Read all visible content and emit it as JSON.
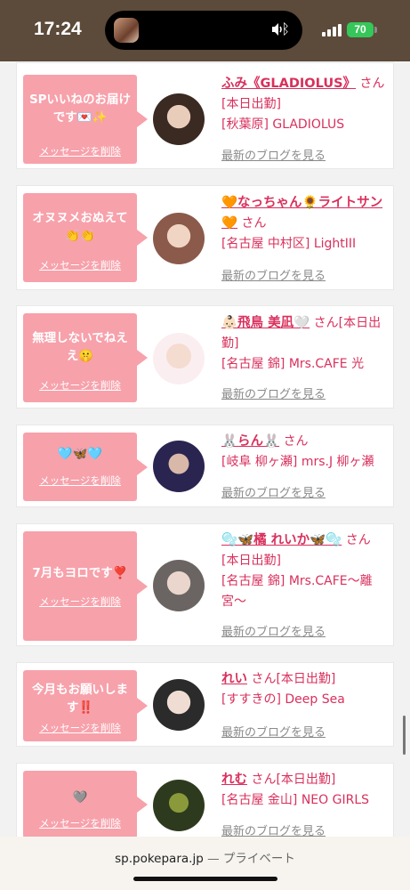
{
  "status": {
    "time": "17:24",
    "battery": "70"
  },
  "cards": [
    {
      "message": "SPいいねのお届けです💌✨",
      "delete": "メッセージを削除",
      "name": "ふみ《GLADIOLUS》",
      "san": "さん",
      "tail": "[本日出勤]",
      "shop": "[秋葉原] GLADIOLUS",
      "blog": "最新のブログを見る"
    },
    {
      "message": "オヌヌメおぬえて👏👏",
      "delete": "メッセージを削除",
      "name": "🧡なっちゃん🌻ライトサン🧡",
      "san": "さん",
      "tail": "",
      "shop": "[名古屋 中村区] LightIII",
      "blog": "最新のブログを見る"
    },
    {
      "message": "無理しないでねええ🤫",
      "delete": "メッセージを削除",
      "name": "👶🏻飛鳥 美凪🤍",
      "san": "さん",
      "tail": "[本日出勤]",
      "shop": "[名古屋 錦] Mrs.CAFE 光",
      "blog": "最新のブログを見る"
    },
    {
      "message": "🩵🦋🩵",
      "delete": "メッセージを削除",
      "name": "🐰らん🐰",
      "san": "さん",
      "tail": "",
      "shop": "[岐阜 柳ヶ瀬] mrs.J 柳ヶ瀬",
      "blog": "最新のブログを見る"
    },
    {
      "message": "7月もヨロです❣️",
      "delete": "メッセージを削除",
      "name": "🫧🦋橘 れいか🦋🫧",
      "san": "さん",
      "tail": "[本日出勤]",
      "shop": "[名古屋 錦] Mrs.CAFE〜離宮〜",
      "blog": "最新のブログを見る"
    },
    {
      "message": "今月もお願いします‼️",
      "delete": "メッセージを削除",
      "name": "れい",
      "san": "さん",
      "tail": "[本日出勤]",
      "shop": "[すすきの] Deep Sea",
      "blog": "最新のブログを見る"
    },
    {
      "message": "🩶",
      "delete": "メッセージを削除",
      "name": "れむ",
      "san": "さん",
      "tail": "[本日出勤]",
      "shop": "[名古屋 金山] NEO GIRLS",
      "blog": "最新のブログを見る"
    }
  ],
  "urlbar": {
    "host": "sp.pokepara.jp",
    "private": "— プライベート"
  }
}
